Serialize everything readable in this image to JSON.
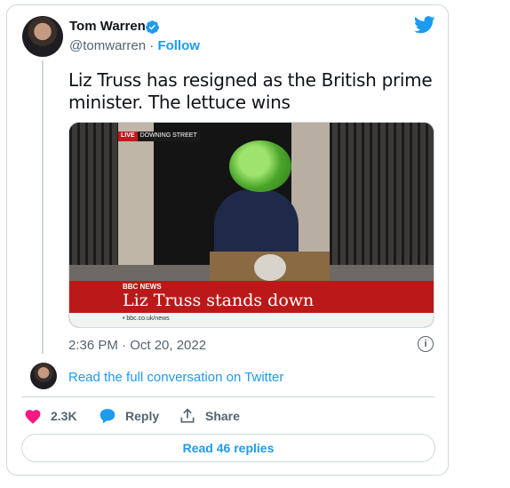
{
  "tweet": {
    "author_name": "Tom Warren",
    "handle": "@tomwarren",
    "separator": "·",
    "follow_label": "Follow",
    "text": "Liz Truss has resigned as the British prime minister. The lettuce wins",
    "timestamp": "2:36 PM · Oct 20, 2022",
    "info_glyph": "i",
    "read_full_label": "Read the full conversation on Twitter",
    "likes_count": "2.3K",
    "reply_label": "Reply",
    "share_label": "Share",
    "read_replies_label": "Read 46 replies"
  },
  "media": {
    "live_tag": "LIVE",
    "location_tag": "DOWNING STREET",
    "channel": "BBC NEWS",
    "headline": "Liz Truss stands down",
    "url": "• bbc.co.uk/news"
  },
  "icons": {
    "brand": "twitter-bird-icon",
    "verified": "verified-badge-icon",
    "like": "heart-icon",
    "reply": "speech-bubble-icon",
    "share": "share-upload-icon",
    "info": "info-icon"
  },
  "colors": {
    "accent": "#1d9bf0",
    "like": "#f91880",
    "text": "#0f1419",
    "muted": "#536471",
    "border": "#cfd9de"
  }
}
